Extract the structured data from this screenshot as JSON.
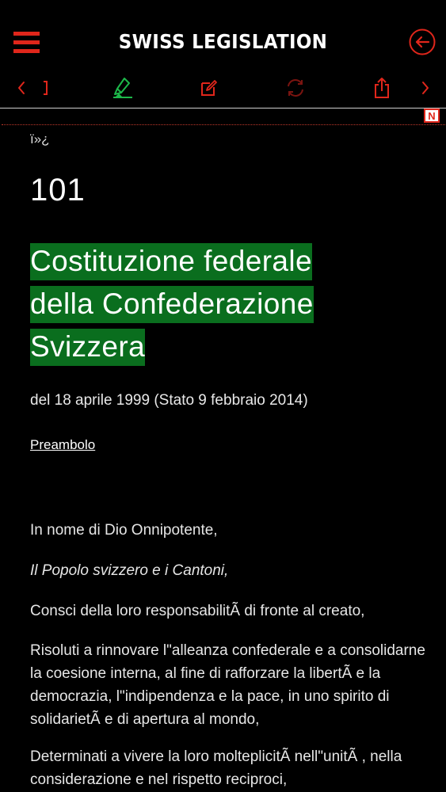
{
  "header": {
    "title": "SWISS LEGISLATION",
    "accent_color": "#e0261b",
    "icons": {
      "menu": "hamburger-menu-icon",
      "back": "circle-arrow-left-icon"
    }
  },
  "toolbar": {
    "items": [
      {
        "name": "prev-icon",
        "glyph": "‹"
      },
      {
        "name": "bracket-icon",
        "glyph": "]"
      },
      {
        "name": "highlighter-icon"
      },
      {
        "name": "edit-note-icon"
      },
      {
        "name": "sync-icon"
      },
      {
        "name": "share-icon"
      },
      {
        "name": "next-icon",
        "glyph": "›"
      }
    ],
    "highlight_color": "#1db84a"
  },
  "note_badge": "N",
  "document": {
    "bom": "ï»¿",
    "number": "101",
    "title_lines": [
      "Costituzione federale",
      "della Confederazione",
      "Svizzera"
    ],
    "highlight_color": "#0a6e1e",
    "date": "del 18 aprile 1999 (Stato 9  febbraio 2014)",
    "preamble_link": "Preambolo",
    "paragraphs": [
      "In nome di Dio Onnipotente,",
      "Il Popolo svizzero e i Cantoni,",
      "Consci della loro responsabilitÃ  di fronte al creato,",
      "Risoluti a rinnovare l\"alleanza confederale e a consolidarne la coesione interna, al fine di rafforzare la libertÃ  e la democrazia, l\"indipendenza e la pace, in uno spirito di solidarietÃ  e di apertura al mondo,",
      "Determinati a vivere la loro molteplicitÃ  nell\"unitÃ , nella considerazione e nel rispetto reciproci,"
    ]
  }
}
